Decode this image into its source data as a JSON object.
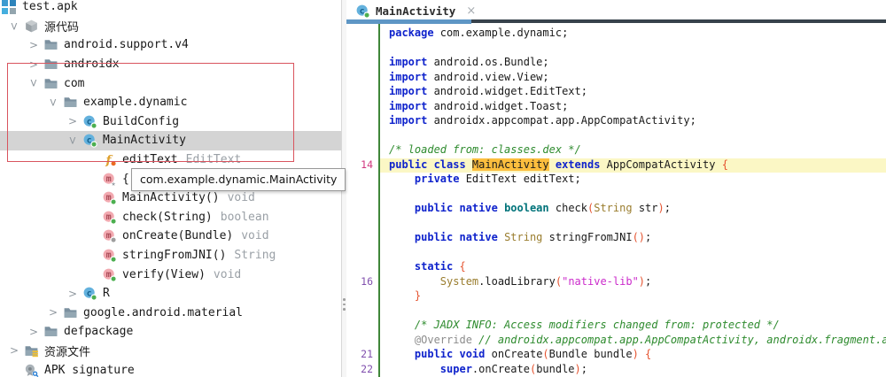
{
  "tree": {
    "tooltip": "com.example.dynamic.MainActivity",
    "items": [
      {
        "id": "test-apk",
        "label": "test.apk",
        "icon": "apk-icon",
        "level": 0,
        "chevron": "none",
        "root": true
      },
      {
        "id": "source-code",
        "label": "源代码",
        "icon": "package-cube-icon",
        "level": 0,
        "chevron": "expanded"
      },
      {
        "id": "android-support-v4",
        "label": "android.support.v4",
        "icon": "folder-icon",
        "level": 1,
        "chevron": "collapsed"
      },
      {
        "id": "androidx",
        "label": "androidx",
        "icon": "folder-icon",
        "level": 1,
        "chevron": "collapsed"
      },
      {
        "id": "com",
        "label": "com",
        "icon": "folder-icon",
        "level": 1,
        "chevron": "expanded"
      },
      {
        "id": "example-dynamic",
        "label": "example.dynamic",
        "icon": "folder-icon",
        "level": 2,
        "chevron": "expanded"
      },
      {
        "id": "buildconfig",
        "label": "BuildConfig",
        "icon": "class-icon",
        "level": 3,
        "chevron": "collapsed"
      },
      {
        "id": "mainactivity",
        "label": "MainActivity",
        "icon": "class-icon",
        "level": 3,
        "chevron": "expanded",
        "selected": true
      },
      {
        "id": "edittext-field",
        "label": "editText",
        "type": "EditText",
        "icon": "field-icon",
        "level": 4,
        "chevron": "none"
      },
      {
        "id": "clinit-block",
        "label": "{...}",
        "type": "",
        "icon": "method-synthetic-icon",
        "level": 4,
        "chevron": "none"
      },
      {
        "id": "mainactivity-ctor",
        "label": "MainActivity()",
        "type": "void",
        "icon": "method-icon",
        "level": 4,
        "chevron": "none"
      },
      {
        "id": "check-method",
        "label": "check(String)",
        "type": "boolean",
        "icon": "method-icon",
        "level": 4,
        "chevron": "none"
      },
      {
        "id": "oncreate-method",
        "label": "onCreate(Bundle)",
        "type": "void",
        "icon": "method-protected-icon",
        "level": 4,
        "chevron": "none"
      },
      {
        "id": "stringfromjni-method",
        "label": "stringFromJNI()",
        "type": "String",
        "icon": "method-icon",
        "level": 4,
        "chevron": "none"
      },
      {
        "id": "verify-method",
        "label": "verify(View)",
        "type": "void",
        "icon": "method-icon",
        "level": 4,
        "chevron": "none"
      },
      {
        "id": "r-class",
        "label": "R",
        "icon": "class-icon",
        "level": 3,
        "chevron": "collapsed"
      },
      {
        "id": "google-android-material",
        "label": "google.android.material",
        "icon": "folder-icon",
        "level": 2,
        "chevron": "collapsed"
      },
      {
        "id": "defpackage",
        "label": "defpackage",
        "icon": "folder-icon",
        "level": 1,
        "chevron": "collapsed"
      },
      {
        "id": "resources",
        "label": "资源文件",
        "icon": "folder-resources-icon",
        "level": 0,
        "chevron": "collapsed"
      },
      {
        "id": "apk-signature",
        "label": "APK signature",
        "icon": "signature-icon",
        "level": 0,
        "chevron": "none"
      }
    ]
  },
  "editor": {
    "tab": {
      "label": "MainActivity",
      "close_glyph": "×",
      "icon": "class-icon"
    },
    "code": {
      "lines": [
        {
          "gutter": "",
          "tokens": [
            [
              "package",
              "k"
            ],
            [
              " com.example.dynamic;",
              "p"
            ]
          ]
        },
        {
          "gutter": "",
          "tokens": []
        },
        {
          "gutter": "",
          "tokens": [
            [
              "import",
              "k"
            ],
            [
              " android.os.Bundle;",
              "p"
            ]
          ]
        },
        {
          "gutter": "",
          "tokens": [
            [
              "import",
              "k"
            ],
            [
              " android.view.View;",
              "p"
            ]
          ]
        },
        {
          "gutter": "",
          "tokens": [
            [
              "import",
              "k"
            ],
            [
              " android.widget.EditText;",
              "p"
            ]
          ]
        },
        {
          "gutter": "",
          "tokens": [
            [
              "import",
              "k"
            ],
            [
              " android.widget.Toast;",
              "p"
            ]
          ]
        },
        {
          "gutter": "",
          "tokens": [
            [
              "import",
              "k"
            ],
            [
              " androidx.appcompat.app.AppCompatActivity;",
              "p"
            ]
          ]
        },
        {
          "gutter": "",
          "tokens": []
        },
        {
          "gutter": "",
          "tokens": [
            [
              "/* loaded from: classes.dex */",
              "m"
            ]
          ]
        },
        {
          "gutter": "14",
          "current": true,
          "highlight": true,
          "tokens": [
            [
              "public class ",
              "k"
            ],
            [
              "MainActivity",
              "hl"
            ],
            [
              " ",
              "p"
            ],
            [
              "extends",
              "k"
            ],
            [
              " AppCompatActivity ",
              "p"
            ],
            [
              "{",
              "r"
            ]
          ]
        },
        {
          "gutter": "",
          "tokens": [
            [
              "    ",
              "p"
            ],
            [
              "private",
              "k"
            ],
            [
              " EditText editText;",
              "p"
            ]
          ]
        },
        {
          "gutter": "",
          "tokens": []
        },
        {
          "gutter": "",
          "tokens": [
            [
              "    ",
              "p"
            ],
            [
              "public native ",
              "k"
            ],
            [
              "boolean",
              "t"
            ],
            [
              " check",
              "p"
            ],
            [
              "(",
              "r"
            ],
            [
              "String",
              "c"
            ],
            [
              " str",
              "p"
            ],
            [
              ")",
              "r"
            ],
            [
              ";",
              "p"
            ]
          ]
        },
        {
          "gutter": "",
          "tokens": []
        },
        {
          "gutter": "",
          "tokens": [
            [
              "    ",
              "p"
            ],
            [
              "public native ",
              "k"
            ],
            [
              "String",
              "c"
            ],
            [
              " stringFromJNI",
              "p"
            ],
            [
              "()",
              "r"
            ],
            [
              ";",
              "p"
            ]
          ]
        },
        {
          "gutter": "",
          "tokens": []
        },
        {
          "gutter": "",
          "tokens": [
            [
              "    ",
              "p"
            ],
            [
              "static",
              "k"
            ],
            [
              " ",
              "p"
            ],
            [
              "{",
              "r"
            ]
          ]
        },
        {
          "gutter": "16",
          "tokens": [
            [
              "        ",
              "p"
            ],
            [
              "System",
              "c"
            ],
            [
              ".loadLibrary",
              "p"
            ],
            [
              "(",
              "r"
            ],
            [
              "\"native-lib\"",
              "s"
            ],
            [
              ")",
              "r"
            ],
            [
              ";",
              "p"
            ]
          ]
        },
        {
          "gutter": "",
          "tokens": [
            [
              "    ",
              "p"
            ],
            [
              "}",
              "r"
            ]
          ]
        },
        {
          "gutter": "",
          "tokens": []
        },
        {
          "gutter": "",
          "tokens": [
            [
              "    ",
              "p"
            ],
            [
              "/* JADX INFO: Access modifiers changed from: protected */",
              "m"
            ]
          ]
        },
        {
          "gutter": "",
          "tokens": [
            [
              "    ",
              "p"
            ],
            [
              "@Override",
              "a"
            ],
            [
              " ",
              "p"
            ],
            [
              "// androidx.appcompat.app.AppCompatActivity, androidx.fragment.a",
              "m"
            ]
          ]
        },
        {
          "gutter": "21",
          "tokens": [
            [
              "    ",
              "p"
            ],
            [
              "public void",
              "k"
            ],
            [
              " onCreate",
              "p"
            ],
            [
              "(",
              "r"
            ],
            [
              "Bundle bundle",
              "p"
            ],
            [
              ")",
              "r"
            ],
            [
              " ",
              "p"
            ],
            [
              "{",
              "r"
            ]
          ]
        },
        {
          "gutter": "22",
          "tokens": [
            [
              "        ",
              "p"
            ],
            [
              "super",
              "k"
            ],
            [
              ".onCreate",
              "p"
            ],
            [
              "(",
              "r"
            ],
            [
              "bundle",
              "p"
            ],
            [
              ")",
              "r"
            ],
            [
              ";",
              "p"
            ]
          ]
        }
      ]
    }
  },
  "colors": {
    "keyword": "#0f23cc",
    "data_type": "#00737a",
    "class_ref": "#9a7d2e",
    "string": "#cb2bcb",
    "comment": "#2e8b2e",
    "annotation": "#8c8c8c",
    "separator": "#e5532f",
    "line_highlight": "#fbf7c5",
    "token_highlight": "#fcbe3e",
    "gutter_number": "#8150ae",
    "gutter_number_current": "#d0377e",
    "tab_underline_active": "#5e96c5",
    "tab_underline_rest": "#37424b",
    "selected_row": "#d4d4d4",
    "annotation_box": "#d9545e",
    "green_gutter_line": "#3f8639"
  }
}
